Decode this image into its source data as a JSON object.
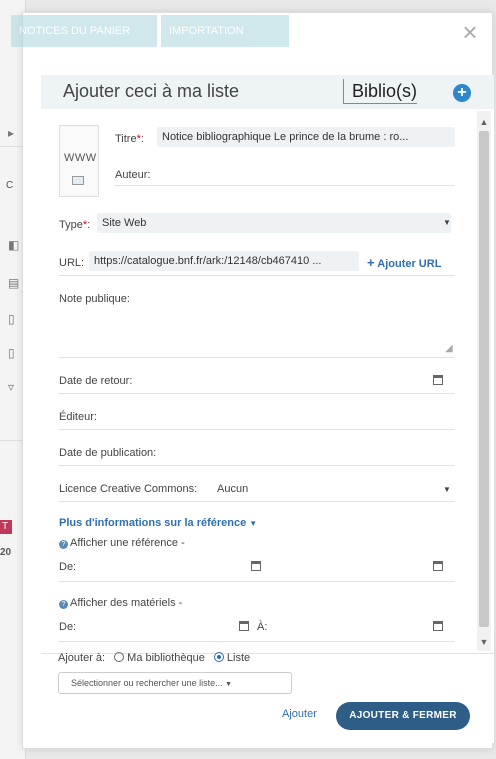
{
  "background": {
    "tab1": "NOTICES DU PANIER",
    "tab2": "IMPORTATION",
    "bg_texts": [
      "C",
      "T",
      "20"
    ]
  },
  "modal": {
    "close_symbol": "×",
    "title": "Ajouter ceci à ma liste",
    "biblio_label": "Biblio(s)",
    "add_symbol": "+"
  },
  "form": {
    "thumbnail_text": "WWW",
    "titre": {
      "label": "Titre",
      "value": "Notice bibliographique Le prince de la brume : ro..."
    },
    "auteur": {
      "label": "Auteur:",
      "value": ""
    },
    "type": {
      "label": "Type",
      "value": "Site Web"
    },
    "url": {
      "label": "URL:",
      "value": "https://catalogue.bnf.fr/ark:/12148/cb467410  ...",
      "add_link": "Ajouter URL"
    },
    "note_publique": {
      "label": "Note publique:"
    },
    "date_retour": {
      "label": "Date de retour:"
    },
    "editeur": {
      "label": "Éditeur:"
    },
    "date_publication": {
      "label": "Date de publication:"
    },
    "licence": {
      "label": "Licence Creative Commons:",
      "value": "Aucun"
    },
    "more_info": "Plus d'informations sur la référence",
    "afficher_reference": {
      "label": "Afficher une référence -",
      "de": "De:"
    },
    "afficher_materiels": {
      "label": "Afficher des matériels -",
      "de": "De:",
      "a": "À:"
    }
  },
  "bottom": {
    "ajouter_a": "Ajouter à:",
    "option_bibliotheque": "Ma bibliothèque",
    "option_liste": "Liste",
    "selected_option": "Liste",
    "select_placeholder": "Sélectionner ou rechercher une liste...",
    "ajouter_button": "Ajouter",
    "ajouter_fermer_button": "AJOUTER & FERMER"
  }
}
